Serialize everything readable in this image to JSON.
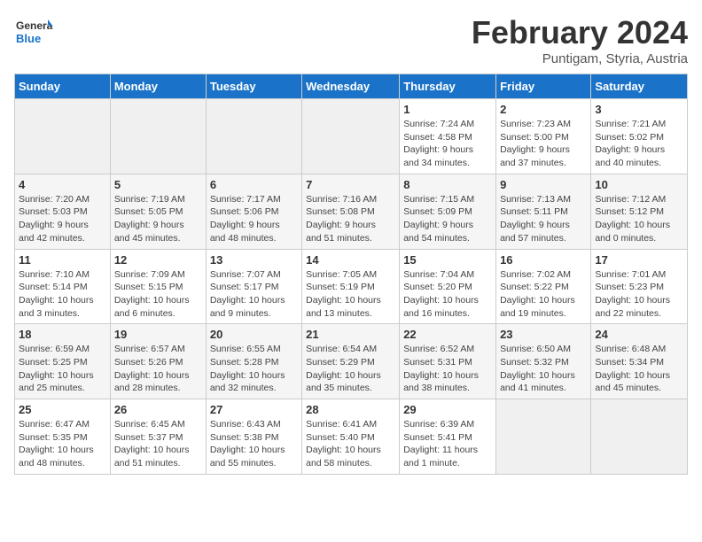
{
  "logo": {
    "text_general": "General",
    "text_blue": "Blue"
  },
  "header": {
    "month": "February 2024",
    "location": "Puntigam, Styria, Austria"
  },
  "weekdays": [
    "Sunday",
    "Monday",
    "Tuesday",
    "Wednesday",
    "Thursday",
    "Friday",
    "Saturday"
  ],
  "weeks": [
    [
      {
        "day": "",
        "info": ""
      },
      {
        "day": "",
        "info": ""
      },
      {
        "day": "",
        "info": ""
      },
      {
        "day": "",
        "info": ""
      },
      {
        "day": "1",
        "info": "Sunrise: 7:24 AM\nSunset: 4:58 PM\nDaylight: 9 hours\nand 34 minutes."
      },
      {
        "day": "2",
        "info": "Sunrise: 7:23 AM\nSunset: 5:00 PM\nDaylight: 9 hours\nand 37 minutes."
      },
      {
        "day": "3",
        "info": "Sunrise: 7:21 AM\nSunset: 5:02 PM\nDaylight: 9 hours\nand 40 minutes."
      }
    ],
    [
      {
        "day": "4",
        "info": "Sunrise: 7:20 AM\nSunset: 5:03 PM\nDaylight: 9 hours\nand 42 minutes."
      },
      {
        "day": "5",
        "info": "Sunrise: 7:19 AM\nSunset: 5:05 PM\nDaylight: 9 hours\nand 45 minutes."
      },
      {
        "day": "6",
        "info": "Sunrise: 7:17 AM\nSunset: 5:06 PM\nDaylight: 9 hours\nand 48 minutes."
      },
      {
        "day": "7",
        "info": "Sunrise: 7:16 AM\nSunset: 5:08 PM\nDaylight: 9 hours\nand 51 minutes."
      },
      {
        "day": "8",
        "info": "Sunrise: 7:15 AM\nSunset: 5:09 PM\nDaylight: 9 hours\nand 54 minutes."
      },
      {
        "day": "9",
        "info": "Sunrise: 7:13 AM\nSunset: 5:11 PM\nDaylight: 9 hours\nand 57 minutes."
      },
      {
        "day": "10",
        "info": "Sunrise: 7:12 AM\nSunset: 5:12 PM\nDaylight: 10 hours\nand 0 minutes."
      }
    ],
    [
      {
        "day": "11",
        "info": "Sunrise: 7:10 AM\nSunset: 5:14 PM\nDaylight: 10 hours\nand 3 minutes."
      },
      {
        "day": "12",
        "info": "Sunrise: 7:09 AM\nSunset: 5:15 PM\nDaylight: 10 hours\nand 6 minutes."
      },
      {
        "day": "13",
        "info": "Sunrise: 7:07 AM\nSunset: 5:17 PM\nDaylight: 10 hours\nand 9 minutes."
      },
      {
        "day": "14",
        "info": "Sunrise: 7:05 AM\nSunset: 5:19 PM\nDaylight: 10 hours\nand 13 minutes."
      },
      {
        "day": "15",
        "info": "Sunrise: 7:04 AM\nSunset: 5:20 PM\nDaylight: 10 hours\nand 16 minutes."
      },
      {
        "day": "16",
        "info": "Sunrise: 7:02 AM\nSunset: 5:22 PM\nDaylight: 10 hours\nand 19 minutes."
      },
      {
        "day": "17",
        "info": "Sunrise: 7:01 AM\nSunset: 5:23 PM\nDaylight: 10 hours\nand 22 minutes."
      }
    ],
    [
      {
        "day": "18",
        "info": "Sunrise: 6:59 AM\nSunset: 5:25 PM\nDaylight: 10 hours\nand 25 minutes."
      },
      {
        "day": "19",
        "info": "Sunrise: 6:57 AM\nSunset: 5:26 PM\nDaylight: 10 hours\nand 28 minutes."
      },
      {
        "day": "20",
        "info": "Sunrise: 6:55 AM\nSunset: 5:28 PM\nDaylight: 10 hours\nand 32 minutes."
      },
      {
        "day": "21",
        "info": "Sunrise: 6:54 AM\nSunset: 5:29 PM\nDaylight: 10 hours\nand 35 minutes."
      },
      {
        "day": "22",
        "info": "Sunrise: 6:52 AM\nSunset: 5:31 PM\nDaylight: 10 hours\nand 38 minutes."
      },
      {
        "day": "23",
        "info": "Sunrise: 6:50 AM\nSunset: 5:32 PM\nDaylight: 10 hours\nand 41 minutes."
      },
      {
        "day": "24",
        "info": "Sunrise: 6:48 AM\nSunset: 5:34 PM\nDaylight: 10 hours\nand 45 minutes."
      }
    ],
    [
      {
        "day": "25",
        "info": "Sunrise: 6:47 AM\nSunset: 5:35 PM\nDaylight: 10 hours\nand 48 minutes."
      },
      {
        "day": "26",
        "info": "Sunrise: 6:45 AM\nSunset: 5:37 PM\nDaylight: 10 hours\nand 51 minutes."
      },
      {
        "day": "27",
        "info": "Sunrise: 6:43 AM\nSunset: 5:38 PM\nDaylight: 10 hours\nand 55 minutes."
      },
      {
        "day": "28",
        "info": "Sunrise: 6:41 AM\nSunset: 5:40 PM\nDaylight: 10 hours\nand 58 minutes."
      },
      {
        "day": "29",
        "info": "Sunrise: 6:39 AM\nSunset: 5:41 PM\nDaylight: 11 hours\nand 1 minute."
      },
      {
        "day": "",
        "info": ""
      },
      {
        "day": "",
        "info": ""
      }
    ]
  ]
}
